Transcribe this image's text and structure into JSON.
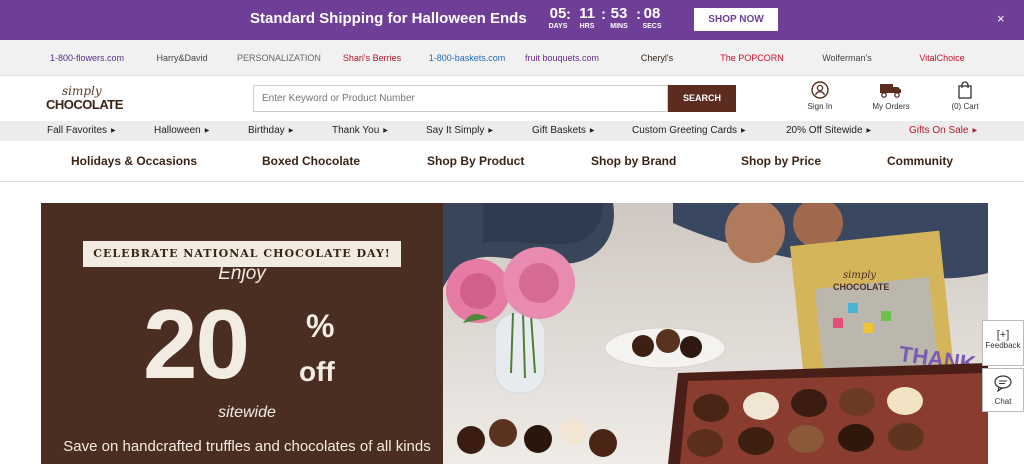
{
  "promo": {
    "title": "Standard Shipping for Halloween Ends",
    "countdown": [
      {
        "value": "05",
        "label": "DAYS"
      },
      {
        "value": "11",
        "label": "HRS"
      },
      {
        "value": "53",
        "label": "MINS"
      },
      {
        "value": "08",
        "label": "SECS"
      }
    ],
    "separator": ":",
    "cta": "SHOP NOW",
    "close": "×"
  },
  "brands": [
    {
      "name": "1-800-flowers.com",
      "color": "#5b2d8e"
    },
    {
      "name": "Harry&David",
      "color": "#444444"
    },
    {
      "name": "PERSONALIZATION MALL",
      "color": "#666666"
    },
    {
      "name": "Shari's Berries",
      "color": "#b3122a"
    },
    {
      "name": "1-800-baskets.com",
      "color": "#1d6db5"
    },
    {
      "name": "fruit bouquets.com",
      "color": "#6a2a8a"
    },
    {
      "name": "Cheryl's",
      "color": "#3b2416"
    },
    {
      "name": "The POPCORN FACTORY",
      "color": "#c8102e"
    },
    {
      "name": "Wolferman's Bakery",
      "color": "#444444"
    },
    {
      "name": "VitalChoice",
      "color": "#c8102e"
    }
  ],
  "header": {
    "logo_top": "simply",
    "logo_bottom": "CHOCOLATE",
    "search_placeholder": "Enter Keyword or Product Number",
    "search_button": "SEARCH",
    "sign_in": "Sign In",
    "my_orders": "My Orders",
    "cart": "(0) Cart"
  },
  "subnav": [
    "Fall Favorites",
    "Halloween",
    "Birthday",
    "Thank You",
    "Say It Simply",
    "Gift Baskets",
    "Custom Greeting Cards",
    "20% Off Sitewide",
    "Gifts On Sale"
  ],
  "mainnav": [
    "Holidays & Occasions",
    "Boxed Chocolate",
    "Shop By Product",
    "Shop by Brand",
    "Shop by Price",
    "Community"
  ],
  "hero": {
    "tagline": "CELEBRATE NATIONAL CHOCOLATE DAY!",
    "enjoy": "Enjoy",
    "number": "20",
    "percent": "%",
    "off": "off",
    "sitewide": "sitewide",
    "body": "Save on handcrafted truffles and chocolates of all kinds",
    "box_label_top": "simply",
    "box_label_bottom": "CHOCOLATE",
    "card_text": "THANK YOU"
  },
  "side": {
    "feedback_icon": "[+]",
    "feedback": "Feedback",
    "chat": "Chat"
  },
  "colors": {
    "promo_bg": "#6f3e97",
    "brand_brown": "#5b2c1f",
    "hero_bg": "#4b2e22",
    "sale_red": "#b11b2c"
  }
}
